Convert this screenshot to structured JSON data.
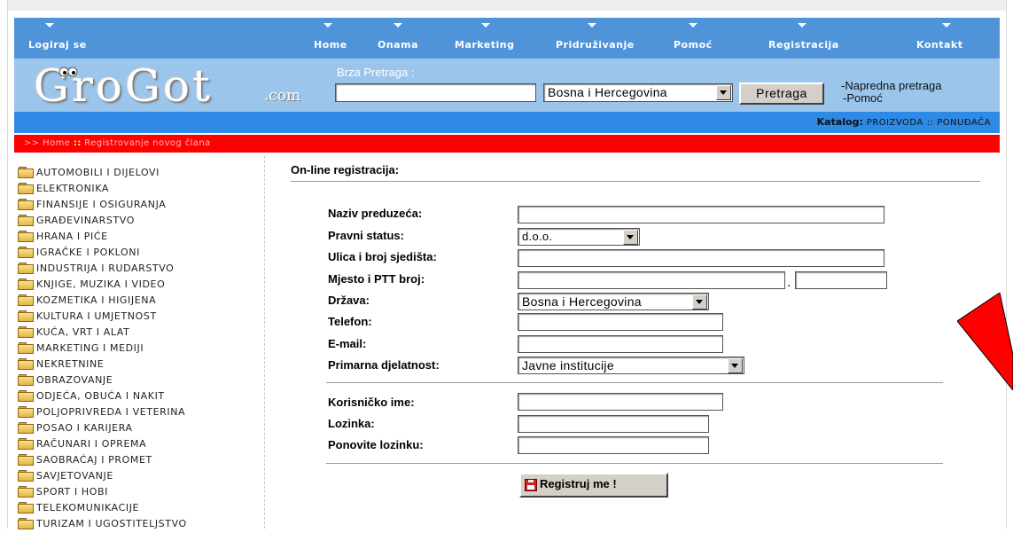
{
  "nav": {
    "items": [
      {
        "label": "Logiraj se"
      },
      {
        "label": "Home"
      },
      {
        "label": "Onama"
      },
      {
        "label": "Marketing"
      },
      {
        "label": "Pridruživanje"
      },
      {
        "label": "Pomoć"
      },
      {
        "label": "Registracija"
      },
      {
        "label": "Kontakt"
      }
    ]
  },
  "header": {
    "logo_text": "GroGot",
    "logo_suffix": ".com",
    "search_label": "Brza Pretraga :",
    "search_value": "",
    "country_selected": "Bosna i Hercegovina",
    "search_button": "Pretraga",
    "advanced_search": "-Napredna pretraga",
    "help": "-Pomoć"
  },
  "catalog": {
    "label": "Katalog:",
    "products": "PROIZVODA",
    "separator": "::",
    "offers": "PONUĐAČA"
  },
  "breadcrumb": {
    "prefix": ">>",
    "home": "Home",
    "separator": "::",
    "current": "Registrovanje novog člana"
  },
  "sidebar": {
    "categories": [
      "AUTOMOBILI I DIJELOVI",
      "ELEKTRONIKA",
      "FINANSIJE I OSIGURANJA",
      "GRAĐEVINARSTVO",
      "HRANA I PIĆE",
      "IGRAČKE I POKLONI",
      "INDUSTRIJA I RUDARSTVO",
      "KNJIGE, MUZIKA I VIDEO",
      "KOZMETIKA I HIGIJENA",
      "KULTURA I UMJETNOST",
      "KUĆA, VRT I ALAT",
      "MARKETING I MEDIJI",
      "NEKRETNINE",
      "OBRAZOVANJE",
      "ODJEĆA, OBUĆA I NAKIT",
      "POLJOPRIVREDA I VETERINA",
      "POSAO I KARIJERA",
      "RAČUNARI I OPREMA",
      "SAOBRAĆAJ I PROMET",
      "SAVJETOVANJE",
      "SPORT I HOBI",
      "TELEKOMUNIKACIJE",
      "TURIZAM I UGOSTITELJSTVO"
    ]
  },
  "form": {
    "title": "On-line registracija:",
    "company_label": "Naziv preduzeća:",
    "company_value": "",
    "legal_label": "Pravni status:",
    "legal_value": "d.o.o.",
    "street_label": "Ulica i broj sjedišta:",
    "street_value": "",
    "city_label": "Mjesto i PTT broj:",
    "city_value": "",
    "ptt_value": "",
    "country_label": "Država:",
    "country_value": "Bosna i Hercegovina",
    "phone_label": "Telefon:",
    "phone_value": "",
    "email_label": "E-mail:",
    "email_value": "",
    "activity_label": "Primarna djelatnost:",
    "activity_value": "Javne institucije",
    "username_label": "Korisničko ime:",
    "username_value": "",
    "password_label": "Lozinka:",
    "repeat_label": "Ponovite lozinku:",
    "submit_label": "Registruj me !"
  },
  "colors": {
    "nav_bg": "#4f93d8",
    "header_bg": "#9cc5ec",
    "catalog_bg": "#2f8ae6",
    "breadcrumb_bg": "#ff0000"
  }
}
